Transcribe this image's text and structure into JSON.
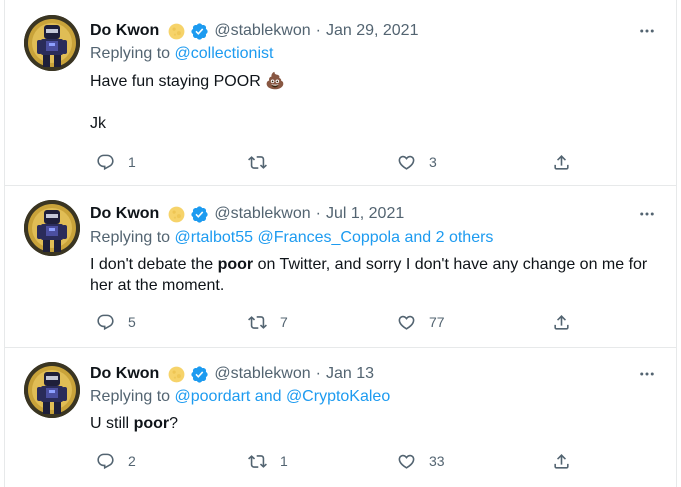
{
  "tweets": [
    {
      "name": "Do Kwon",
      "handle": "@stablekwon",
      "date": "Jan 29, 2021",
      "replying_prefix": "Replying to ",
      "mentions": [
        "@collectionist"
      ],
      "mentions_suffix": "",
      "text_before": "Have fun staying POOR ",
      "emoji": "💩",
      "text_line2": "Jk",
      "replies": "1",
      "retweets": "",
      "likes": "3"
    },
    {
      "name": "Do Kwon",
      "handle": "@stablekwon",
      "date": "Jul 1, 2021",
      "replying_prefix": "Replying to ",
      "mentions": [
        "@rtalbot55",
        "@Frances_Coppola"
      ],
      "mentions_suffix": " and 2 others",
      "text_before": "I don't debate the ",
      "text_bold": "poor",
      "text_after": " on Twitter, and sorry I don't have any change on me for her at the moment.",
      "replies": "5",
      "retweets": "7",
      "likes": "77"
    },
    {
      "name": "Do Kwon",
      "handle": "@stablekwon",
      "date": "Jan 13",
      "replying_prefix": "Replying to ",
      "mentions": [
        "@poordart"
      ],
      "mentions_join": " and ",
      "mentions2": "@CryptoKaleo",
      "text_before": "U still ",
      "text_bold": "poor",
      "text_after": "?",
      "replies": "2",
      "retweets": "1",
      "likes": "33"
    }
  ],
  "colors": {
    "accent": "#1d9bf0",
    "secondary_text": "#536471",
    "primary_text": "#0f1419",
    "divider": "#e7e9ea",
    "moon": "#f6d36a"
  },
  "icons": [
    "reply-icon",
    "retweet-icon",
    "like-icon",
    "share-icon",
    "more-icon",
    "verified-icon",
    "moon-icon"
  ]
}
